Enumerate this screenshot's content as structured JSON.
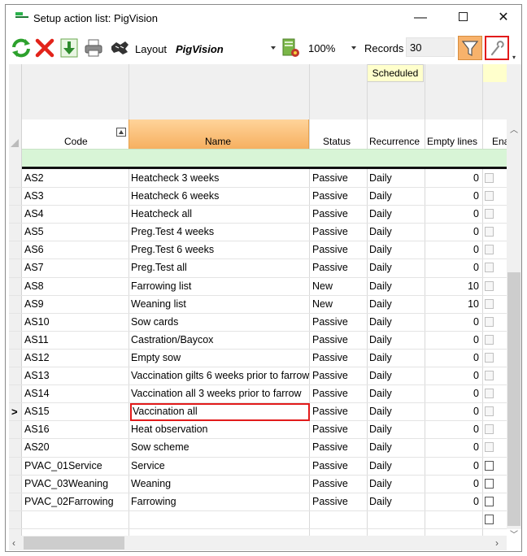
{
  "window": {
    "title": "Setup action list: PigVision",
    "minimize_glyph": "—",
    "close_glyph": "✕"
  },
  "toolbar": {
    "layout_label": "Layout",
    "layout_value": "PigVision",
    "zoom_value": "100%",
    "records_label": "Records",
    "records_value": "30",
    "chevron_glyph": "▾"
  },
  "grid": {
    "scheduled_label": "Scheduled",
    "columns": {
      "code": "Code",
      "name": "Name",
      "status": "Status",
      "recurrence": "Recurrence",
      "empty_lines": "Empty lines",
      "enabled": "Ena"
    },
    "current_row_marker": ">",
    "rows": [
      {
        "code": "AS2",
        "name": "Heatcheck 3 weeks",
        "status": "Passive",
        "recurrence": "Daily",
        "empty": "0"
      },
      {
        "code": "AS3",
        "name": "Heatcheck 6 weeks",
        "status": "Passive",
        "recurrence": "Daily",
        "empty": "0"
      },
      {
        "code": "AS4",
        "name": "Heatcheck all",
        "status": "Passive",
        "recurrence": "Daily",
        "empty": "0"
      },
      {
        "code": "AS5",
        "name": "Preg.Test 4 weeks",
        "status": "Passive",
        "recurrence": "Daily",
        "empty": "0"
      },
      {
        "code": "AS6",
        "name": "Preg.Test 6 weeks",
        "status": "Passive",
        "recurrence": "Daily",
        "empty": "0"
      },
      {
        "code": "AS7",
        "name": "Preg.Test all",
        "status": "Passive",
        "recurrence": "Daily",
        "empty": "0"
      },
      {
        "code": "AS8",
        "name": "Farrowing list",
        "status": "New",
        "recurrence": "Daily",
        "empty": "10"
      },
      {
        "code": "AS9",
        "name": "Weaning list",
        "status": "New",
        "recurrence": "Daily",
        "empty": "10"
      },
      {
        "code": "AS10",
        "name": "Sow cards",
        "status": "Passive",
        "recurrence": "Daily",
        "empty": "0"
      },
      {
        "code": "AS11",
        "name": "Castration/Baycox",
        "status": "Passive",
        "recurrence": "Daily",
        "empty": "0"
      },
      {
        "code": "AS12",
        "name": "Empty sow",
        "status": "Passive",
        "recurrence": "Daily",
        "empty": "0"
      },
      {
        "code": "AS13",
        "name": "Vaccination gilts 6 weeks prior to farrow",
        "status": "Passive",
        "recurrence": "Daily",
        "empty": "0"
      },
      {
        "code": "AS14",
        "name": "Vaccination all 3 weeks prior to farrow",
        "status": "Passive",
        "recurrence": "Daily",
        "empty": "0"
      },
      {
        "code": "AS15",
        "name": "Vaccination all",
        "status": "Passive",
        "recurrence": "Daily",
        "empty": "0"
      },
      {
        "code": "AS16",
        "name": "Heat observation",
        "status": "Passive",
        "recurrence": "Daily",
        "empty": "0"
      },
      {
        "code": "AS20",
        "name": "Sow scheme",
        "status": "Passive",
        "recurrence": "Daily",
        "empty": "0"
      },
      {
        "code": "PVAC_01Service",
        "name": "Service",
        "status": "Passive",
        "recurrence": "Daily",
        "empty": "0"
      },
      {
        "code": "PVAC_03Weaning",
        "name": "Weaning",
        "status": "Passive",
        "recurrence": "Daily",
        "empty": "0"
      },
      {
        "code": "PVAC_02Farrowing",
        "name": "Farrowing",
        "status": "Passive",
        "recurrence": "Daily",
        "empty": "0"
      }
    ]
  },
  "colors": {
    "accent_orange": "#f6b060",
    "filter_row_green": "#d8f5d6",
    "highlight_red": "#e21b1b",
    "scheduled_yellow": "#ffffcc"
  }
}
